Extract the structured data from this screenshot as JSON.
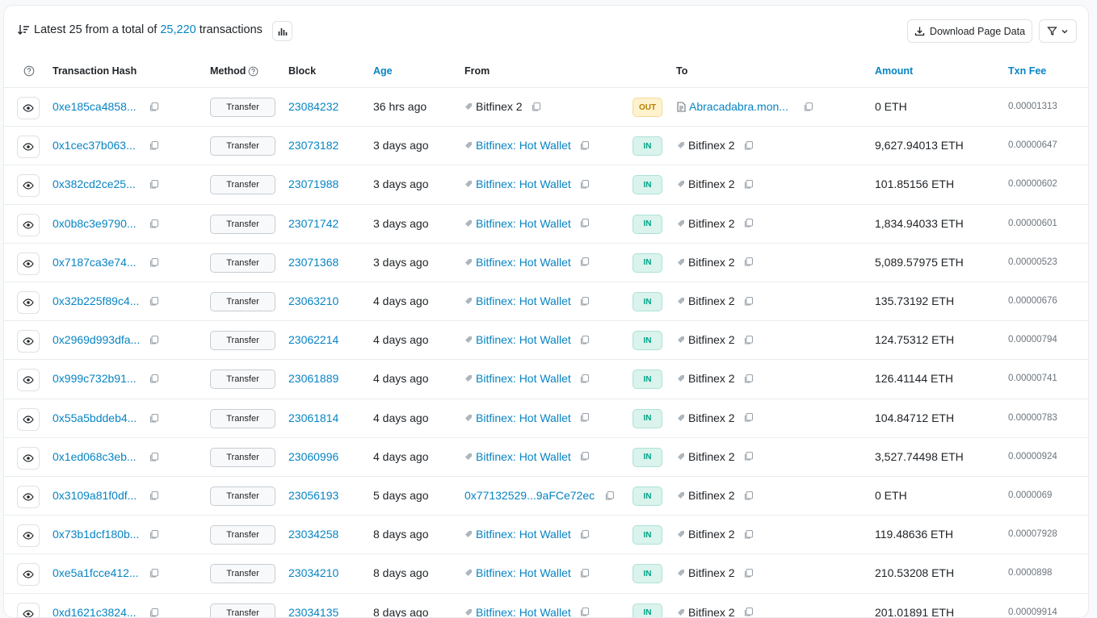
{
  "summary": {
    "prefix": "Latest 25 from a total of",
    "total": "25,220",
    "suffix": "transactions"
  },
  "toolbar": {
    "download_label": "Download Page Data"
  },
  "columns": {
    "hash": "Transaction Hash",
    "method": "Method",
    "block": "Block",
    "age": "Age",
    "from": "From",
    "to": "To",
    "amount": "Amount",
    "fee": "Txn Fee"
  },
  "colors": {
    "link": "#0784c3",
    "in_badge": "#00a186",
    "out_badge": "#b47d00"
  },
  "rows": [
    {
      "hash": "0xe185ca4858...",
      "method": "Transfer",
      "block": "23084232",
      "age": "36 hrs ago",
      "from": "Bitfinex 2",
      "from_type": "plain",
      "direction": "OUT",
      "to": "Abracadabra.mon...",
      "to_type": "contract",
      "amount": "0 ETH",
      "fee": "0.00001313"
    },
    {
      "hash": "0x1cec37b063...",
      "method": "Transfer",
      "block": "23073182",
      "age": "3 days ago",
      "from": "Bitfinex: Hot Wallet",
      "from_type": "link",
      "direction": "IN",
      "to": "Bitfinex 2",
      "to_type": "plain",
      "amount": "9,627.94013 ETH",
      "fee": "0.00000647"
    },
    {
      "hash": "0x382cd2ce25...",
      "method": "Transfer",
      "block": "23071988",
      "age": "3 days ago",
      "from": "Bitfinex: Hot Wallet",
      "from_type": "link",
      "direction": "IN",
      "to": "Bitfinex 2",
      "to_type": "plain",
      "amount": "101.85156 ETH",
      "fee": "0.00000602"
    },
    {
      "hash": "0x0b8c3e9790...",
      "method": "Transfer",
      "block": "23071742",
      "age": "3 days ago",
      "from": "Bitfinex: Hot Wallet",
      "from_type": "link",
      "direction": "IN",
      "to": "Bitfinex 2",
      "to_type": "plain",
      "amount": "1,834.94033 ETH",
      "fee": "0.00000601"
    },
    {
      "hash": "0x7187ca3e74...",
      "method": "Transfer",
      "block": "23071368",
      "age": "3 days ago",
      "from": "Bitfinex: Hot Wallet",
      "from_type": "link",
      "direction": "IN",
      "to": "Bitfinex 2",
      "to_type": "plain",
      "amount": "5,089.57975 ETH",
      "fee": "0.00000523"
    },
    {
      "hash": "0x32b225f89c4...",
      "method": "Transfer",
      "block": "23063210",
      "age": "4 days ago",
      "from": "Bitfinex: Hot Wallet",
      "from_type": "link",
      "direction": "IN",
      "to": "Bitfinex 2",
      "to_type": "plain",
      "amount": "135.73192 ETH",
      "fee": "0.00000676"
    },
    {
      "hash": "0x2969d993dfa...",
      "method": "Transfer",
      "block": "23062214",
      "age": "4 days ago",
      "from": "Bitfinex: Hot Wallet",
      "from_type": "link",
      "direction": "IN",
      "to": "Bitfinex 2",
      "to_type": "plain",
      "amount": "124.75312 ETH",
      "fee": "0.00000794"
    },
    {
      "hash": "0x999c732b91...",
      "method": "Transfer",
      "block": "23061889",
      "age": "4 days ago",
      "from": "Bitfinex: Hot Wallet",
      "from_type": "link",
      "direction": "IN",
      "to": "Bitfinex 2",
      "to_type": "plain",
      "amount": "126.41144 ETH",
      "fee": "0.00000741"
    },
    {
      "hash": "0x55a5bddeb4...",
      "method": "Transfer",
      "block": "23061814",
      "age": "4 days ago",
      "from": "Bitfinex: Hot Wallet",
      "from_type": "link",
      "direction": "IN",
      "to": "Bitfinex 2",
      "to_type": "plain",
      "amount": "104.84712 ETH",
      "fee": "0.00000783"
    },
    {
      "hash": "0x1ed068c3eb...",
      "method": "Transfer",
      "block": "23060996",
      "age": "4 days ago",
      "from": "Bitfinex: Hot Wallet",
      "from_type": "link",
      "direction": "IN",
      "to": "Bitfinex 2",
      "to_type": "plain",
      "amount": "3,527.74498 ETH",
      "fee": "0.00000924"
    },
    {
      "hash": "0x3109a81f0df...",
      "method": "Transfer",
      "block": "23056193",
      "age": "5 days ago",
      "from": "0x77132529...9aFCe72ec",
      "from_type": "address",
      "direction": "IN",
      "to": "Bitfinex 2",
      "to_type": "plain",
      "amount": "0 ETH",
      "fee": "0.0000069"
    },
    {
      "hash": "0x73b1dcf180b...",
      "method": "Transfer",
      "block": "23034258",
      "age": "8 days ago",
      "from": "Bitfinex: Hot Wallet",
      "from_type": "link",
      "direction": "IN",
      "to": "Bitfinex 2",
      "to_type": "plain",
      "amount": "119.48636 ETH",
      "fee": "0.00007928"
    },
    {
      "hash": "0xe5a1fcce412...",
      "method": "Transfer",
      "block": "23034210",
      "age": "8 days ago",
      "from": "Bitfinex: Hot Wallet",
      "from_type": "link",
      "direction": "IN",
      "to": "Bitfinex 2",
      "to_type": "plain",
      "amount": "210.53208 ETH",
      "fee": "0.0000898"
    },
    {
      "hash": "0xd1621c3824...",
      "method": "Transfer",
      "block": "23034135",
      "age": "8 days ago",
      "from": "Bitfinex: Hot Wallet",
      "from_type": "link",
      "direction": "IN",
      "to": "Bitfinex 2",
      "to_type": "plain",
      "amount": "201.01891 ETH",
      "fee": "0.00009914"
    }
  ]
}
